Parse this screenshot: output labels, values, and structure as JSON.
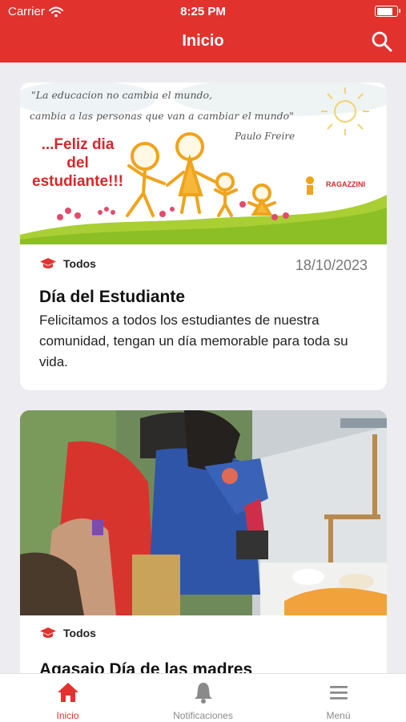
{
  "status_bar": {
    "carrier": "Carrier",
    "time": "8:25 PM",
    "battery_level": 0.95
  },
  "header": {
    "title": "Inicio"
  },
  "posts": [
    {
      "banner": {
        "quote_line1": "\"La educacion no cambia el mundo,",
        "quote_line2": "cambia a las personas que van a cambiar el mundo\"",
        "quote_author": "Paulo Freire",
        "headline": "...Feliz dia del estudiante!!!",
        "logo_text": "RAGAZZINI"
      },
      "category": "Todos",
      "date": "18/10/2023",
      "title": "Día del Estudiante",
      "body": "Felicitamos a todos los estudiantes de nuestra comunidad, tengan un día memorable para toda su vida."
    },
    {
      "category": "Todos",
      "title": "Agasajo Día de las madres"
    }
  ],
  "tabs": [
    {
      "label": "Inicio",
      "icon": "home-icon",
      "active": true
    },
    {
      "label": "Notificaciones",
      "icon": "bell-icon",
      "active": false
    },
    {
      "label": "Menú",
      "icon": "menu-icon",
      "active": false
    }
  ],
  "colors": {
    "primary": "#e2322e",
    "background": "#ececf1",
    "inactive": "#8a8a8a"
  }
}
